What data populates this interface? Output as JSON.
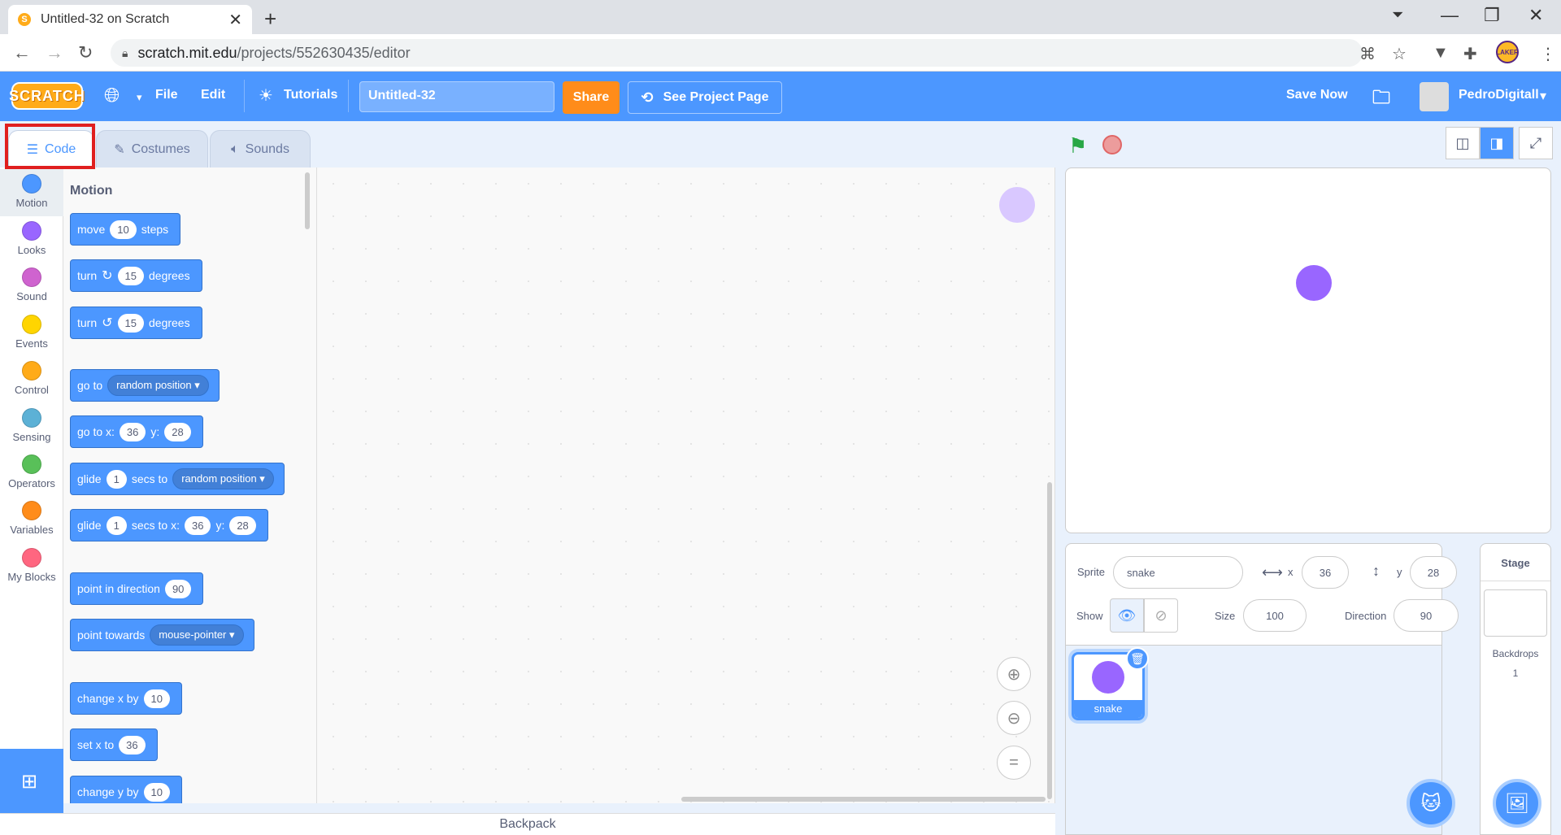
{
  "browser": {
    "tab_title": "Untitled-32 on Scratch",
    "favicon_text": "S",
    "url_host": "scratch.mit.edu",
    "url_path": "/projects/552630435/editor",
    "profile_text": "LAKER"
  },
  "menubar": {
    "logo_text": "SCRATCH",
    "file": "File",
    "edit": "Edit",
    "tutorials": "Tutorials",
    "project_title": "Untitled-32",
    "share": "Share",
    "see_project_page": "See Project Page",
    "save_now": "Save Now",
    "username": "PedroDigitall"
  },
  "editor_tabs": {
    "code": "Code",
    "costumes": "Costumes",
    "sounds": "Sounds"
  },
  "categories": [
    {
      "label": "Motion",
      "color": "#4c97ff"
    },
    {
      "label": "Looks",
      "color": "#9966ff"
    },
    {
      "label": "Sound",
      "color": "#cf63cf"
    },
    {
      "label": "Events",
      "color": "#ffd500"
    },
    {
      "label": "Control",
      "color": "#ffab19"
    },
    {
      "label": "Sensing",
      "color": "#5cb1d6"
    },
    {
      "label": "Operators",
      "color": "#59c059"
    },
    {
      "label": "Variables",
      "color": "#ff8c1a"
    },
    {
      "label": "My Blocks",
      "color": "#ff6680"
    }
  ],
  "palette": {
    "heading": "Motion",
    "move": {
      "t1": "move",
      "v1": "10",
      "t2": "steps"
    },
    "turn_right": {
      "t1": "turn",
      "v1": "15",
      "t2": "degrees"
    },
    "turn_left": {
      "t1": "turn",
      "v1": "15",
      "t2": "degrees"
    },
    "goto": {
      "t1": "go to",
      "d1": "random position"
    },
    "goto_xy": {
      "t1": "go to x:",
      "v1": "36",
      "t2": "y:",
      "v2": "28"
    },
    "glide_to": {
      "t1": "glide",
      "v1": "1",
      "t2": "secs to",
      "d1": "random position"
    },
    "glide_xy": {
      "t1": "glide",
      "v1": "1",
      "t2": "secs to x:",
      "v2": "36",
      "t3": "y:",
      "v3": "28"
    },
    "point_dir": {
      "t1": "point in direction",
      "v1": "90"
    },
    "point_towards": {
      "t1": "point towards",
      "d1": "mouse-pointer"
    },
    "change_x": {
      "t1": "change x by",
      "v1": "10"
    },
    "set_x": {
      "t1": "set x to",
      "v1": "36"
    },
    "change_y": {
      "t1": "change y by",
      "v1": "10"
    }
  },
  "backpack": "Backpack",
  "sprite_info": {
    "sprite_label": "Sprite",
    "sprite_name": "snake",
    "x_label": "x",
    "x_value": "36",
    "y_label": "y",
    "y_value": "28",
    "show_label": "Show",
    "size_label": "Size",
    "size_value": "100",
    "direction_label": "Direction",
    "direction_value": "90"
  },
  "sprites": [
    {
      "name": "snake"
    }
  ],
  "stage_panel": {
    "title": "Stage",
    "backdrops_label": "Backdrops",
    "backdrops_count": "1"
  }
}
